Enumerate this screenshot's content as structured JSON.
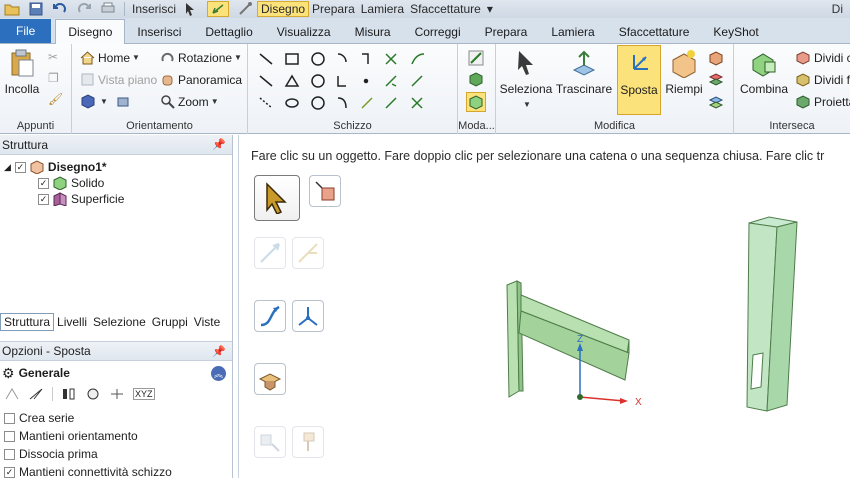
{
  "qat": {
    "inserisci": "Inserisci",
    "disegno": "Disegno",
    "prepara": "Prepara",
    "lamiera": "Lamiera",
    "sfaccettature": "Sfaccettature",
    "title": "Di"
  },
  "tabs": {
    "file": "File",
    "items": [
      "Disegno",
      "Inserisci",
      "Dettaglio",
      "Visualizza",
      "Misura",
      "Correggi",
      "Prepara",
      "Lamiera",
      "Sfaccettature",
      "KeyShot"
    ]
  },
  "ribbon": {
    "appunti": {
      "label": "Appunti",
      "incolla": "Incolla"
    },
    "orientamento": {
      "label": "Orientamento",
      "home": "Home",
      "vista_piano": "Vista piano",
      "rotazione": "Rotazione",
      "panoramica": "Panoramica",
      "zoom": "Zoom"
    },
    "schizzo": {
      "label": "Schizzo"
    },
    "modalita": {
      "label": "Moda..."
    },
    "modifica": {
      "label": "Modifica",
      "seleziona": "Seleziona",
      "trascinare": "Trascinare",
      "sposta": "Sposta",
      "riempi": "Riempi"
    },
    "interseca": {
      "label": "Interseca",
      "combina": "Combina",
      "dividi1": "Dividi c",
      "dividi2": "Dividi fa",
      "proietta": "Proietta"
    }
  },
  "structure": {
    "header": "Struttura",
    "root": "Disegno1*",
    "children": [
      "Solido",
      "Superficie"
    ],
    "tabs": [
      "Struttura",
      "Livelli",
      "Selezione",
      "Gruppi",
      "Viste"
    ]
  },
  "options": {
    "header": "Opzioni - Sposta",
    "section": "Generale",
    "axis_label": "XYZ",
    "checks": [
      {
        "label": "Crea serie",
        "checked": false
      },
      {
        "label": "Mantieni orientamento",
        "checked": false
      },
      {
        "label": "Dissocia prima",
        "checked": false
      },
      {
        "label": "Mantieni connettività schizzo",
        "checked": true
      }
    ]
  },
  "canvas": {
    "hint": "Fare clic su un oggetto. Fare doppio clic per selezionare una catena o una sequenza chiusa. Fare clic tr",
    "axis_z": "Z",
    "axis_x": "X"
  },
  "colors": {
    "accent": "#2c6fbf",
    "highlight": "#fbe27a",
    "solid_fill": "#a9d6a0",
    "solid_stroke": "#4f7d4a"
  }
}
